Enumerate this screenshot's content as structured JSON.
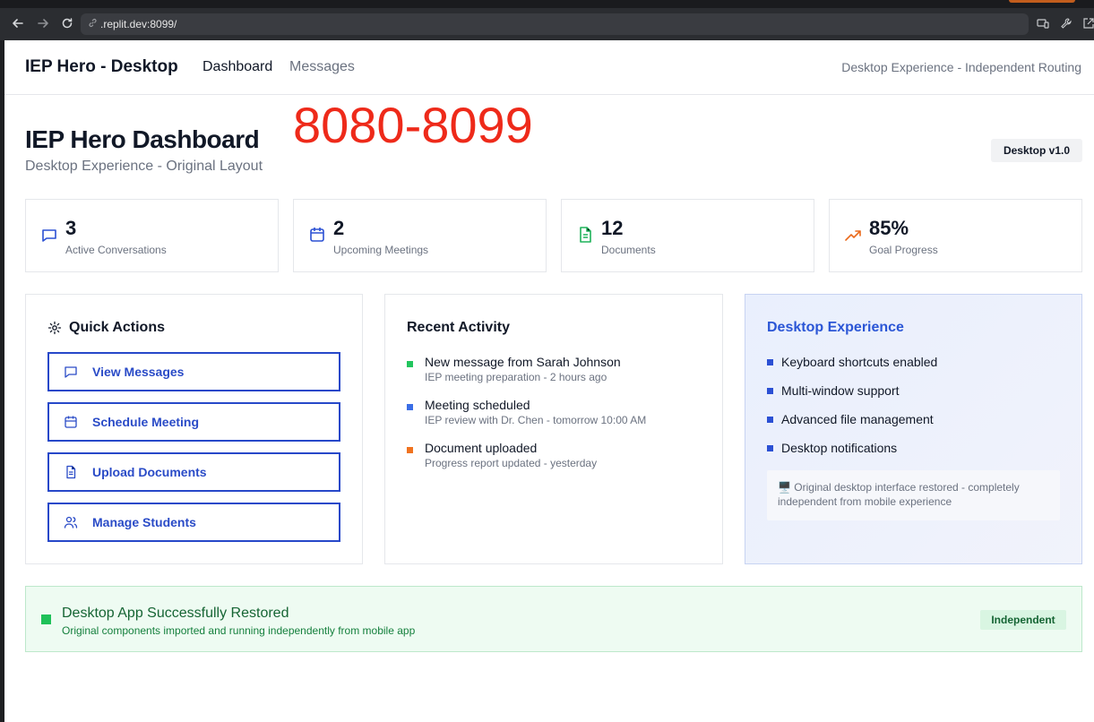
{
  "browser": {
    "url": ".replit.dev:8099/"
  },
  "topnav": {
    "brand": "IEP Hero - Desktop",
    "links": [
      "Dashboard",
      "Messages"
    ],
    "right_text": "Desktop Experience - Independent Routing"
  },
  "header": {
    "title": "IEP Hero Dashboard",
    "subtitle": "Desktop Experience - Original Layout",
    "port_overlay": "8080-8099",
    "version_badge": "Desktop v1.0"
  },
  "stats": [
    {
      "value": "3",
      "label": "Active Conversations",
      "icon": "message-square-icon",
      "color": "#2b50d4"
    },
    {
      "value": "2",
      "label": "Upcoming Meetings",
      "icon": "calendar-icon",
      "color": "#2b50d4"
    },
    {
      "value": "12",
      "label": "Documents",
      "icon": "file-text-icon",
      "color": "#1fb35a"
    },
    {
      "value": "85%",
      "label": "Goal Progress",
      "icon": "trending-up-icon",
      "color": "#ea6a1c"
    }
  ],
  "quick_actions": {
    "title": "Quick Actions",
    "buttons": [
      "View Messages",
      "Schedule Meeting",
      "Upload Documents",
      "Manage Students"
    ]
  },
  "recent_activity": {
    "title": "Recent Activity",
    "items": [
      {
        "title": "New message from Sarah Johnson",
        "sub": "IEP meeting preparation - 2 hours ago",
        "color": "#22c55e"
      },
      {
        "title": "Meeting scheduled",
        "sub": "IEP review with Dr. Chen - tomorrow 10:00 AM",
        "color": "#3b6ee6"
      },
      {
        "title": "Document uploaded",
        "sub": "Progress report updated - yesterday",
        "color": "#f07320"
      }
    ]
  },
  "desktop_experience": {
    "title": "Desktop Experience",
    "features": [
      "Keyboard shortcuts enabled",
      "Multi-window support",
      "Advanced file management",
      "Desktop notifications"
    ],
    "note": "🖥️ Original desktop interface restored - completely independent from mobile experience"
  },
  "success_banner": {
    "title": "Desktop App Successfully Restored",
    "subtitle": "Original components imported and running independently from mobile app",
    "badge": "Independent"
  }
}
